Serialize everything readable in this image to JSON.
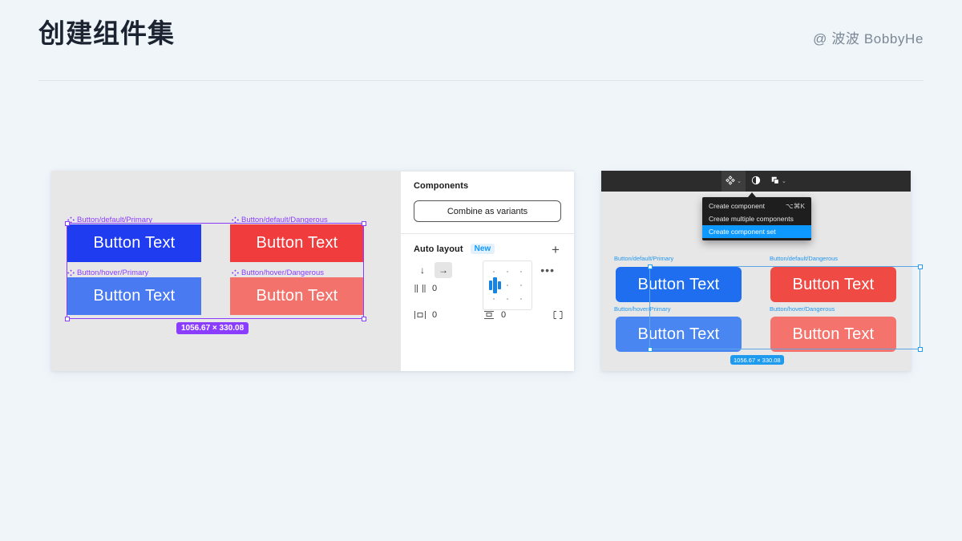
{
  "header": {
    "title": "创建组件集",
    "attribution": "@ 波波 BobbyHe"
  },
  "left_card": {
    "components": [
      {
        "label": "Button/default/Primary",
        "text": "Button Text",
        "color": "#1f3cf0"
      },
      {
        "label": "Button/default/Dangerous",
        "text": "Button Text",
        "color": "#f03c3c"
      },
      {
        "label": "Button/hover/Primary",
        "text": "Button Text",
        "color": "#4a7af2"
      },
      {
        "label": "Button/hover/Dangerous",
        "text": "Button Text",
        "color": "#f4726c"
      }
    ],
    "selection_size": "1056.67 × 330.08",
    "selection_color": "#8b3dff"
  },
  "inspector": {
    "components_title": "Components",
    "combine_button": "Combine as variants",
    "autolayout_title": "Auto layout",
    "autolayout_badge": "New",
    "add_label": "+",
    "more_label": "•••",
    "direction_vertical": "↓",
    "direction_horizontal": "→",
    "gap_value": "0",
    "padding_horizontal": "0",
    "padding_vertical": "0",
    "gap_icon": "]|[",
    "padding_h_icon": "|▫|",
    "padding_v_icon": "▫",
    "corner_icon": "⌐"
  },
  "right_card": {
    "toolbar": {
      "component_icon": "component-icon",
      "mask_icon": "mask-icon",
      "boolean_icon": "boolean-icon",
      "chevron": "⌄"
    },
    "menu": {
      "items": [
        {
          "label": "Create component",
          "shortcut": "⌥⌘K",
          "selected": false
        },
        {
          "label": "Create multiple components",
          "shortcut": "",
          "selected": false
        },
        {
          "label": "Create component set",
          "shortcut": "",
          "selected": true
        }
      ],
      "highlight_color": "#0d99ff"
    },
    "components": [
      {
        "label": "Button/default/Primary",
        "text": "Button Text",
        "color": "#1f6ef0"
      },
      {
        "label": "Button/default/Dangerous",
        "text": "Button Text",
        "color": "#f04a44"
      },
      {
        "label": "Button/hover/Primary",
        "text": "Button Text",
        "color": "#4a86f2"
      },
      {
        "label": "Button/hover/Dangerous",
        "text": "Button Text",
        "color": "#f4736c"
      }
    ],
    "selection_size": "1056.67 × 330.08",
    "selection_color": "#1e9aef"
  }
}
